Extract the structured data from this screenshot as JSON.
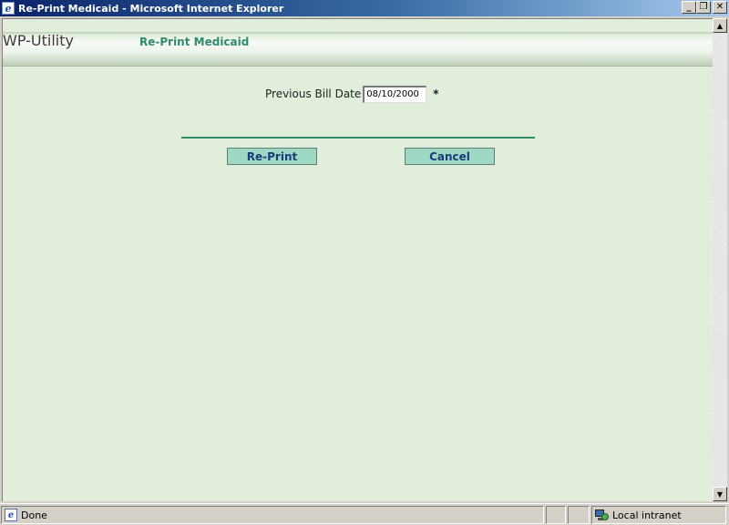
{
  "window": {
    "title": "Re-Print Medicaid - Microsoft Internet Explorer",
    "buttons": {
      "minimize": "_",
      "maximize": "❐",
      "close": "✕"
    }
  },
  "header": {
    "app_name": "WP-Utility",
    "page_title": "Re-Print Medicaid"
  },
  "form": {
    "previous_bill_date_label": "Previous Bill Date",
    "previous_bill_date_value": "08/10/2000",
    "required_marker": "*"
  },
  "actions": {
    "reprint_label": "Re-Print",
    "cancel_label": "Cancel"
  },
  "statusbar": {
    "status_text": "Done",
    "zone_text": "Local intranet"
  },
  "colors": {
    "page_background": "#e0eedb",
    "accent_green": "#2e8b6a",
    "button_background": "#9ed8c2",
    "button_text": "#1a3a7a"
  },
  "icons": {
    "title_icon": "ie-page-icon",
    "status_icon": "ie-page-icon",
    "zone_icon": "local-intranet-icon"
  }
}
